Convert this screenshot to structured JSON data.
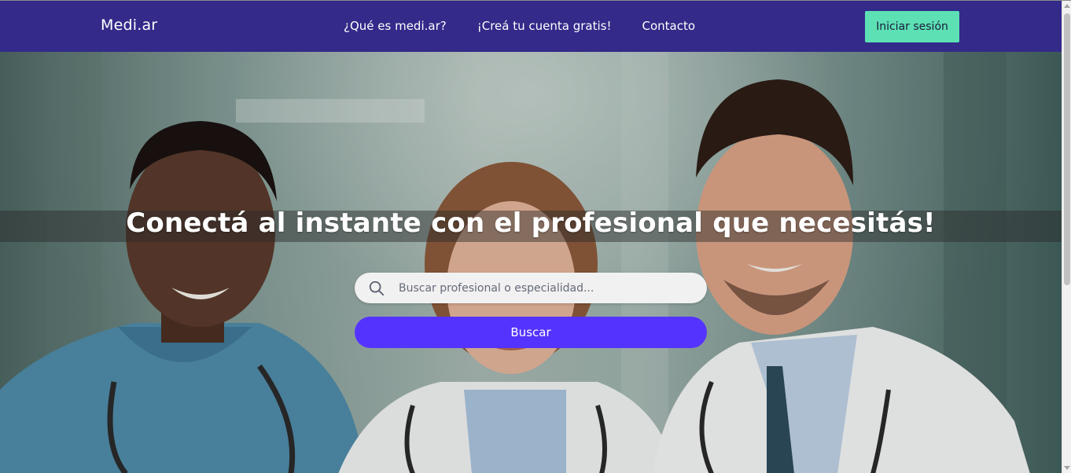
{
  "navbar": {
    "brand": "Medi.ar",
    "links": [
      {
        "label": "¿Qué es medi.ar?"
      },
      {
        "label": "¡Creá tu cuenta gratis!"
      },
      {
        "label": "Contacto"
      }
    ],
    "login_label": "Iniciar sesión"
  },
  "hero": {
    "headline": "Conectá al instante con el profesional que necesitás!",
    "search_placeholder": "Buscar profesional o especialidad...",
    "search_button_label": "Buscar",
    "image": "photo of three smiling doctors in a hospital hallway"
  },
  "colors": {
    "navbar": "#332a89",
    "login_button": "#5ce0b4",
    "search_button": "#5533ff"
  },
  "icons": [
    "search-icon"
  ]
}
